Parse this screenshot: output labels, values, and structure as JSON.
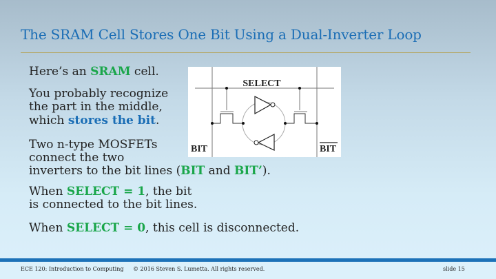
{
  "title": "The SRAM Cell Stores One Bit Using a Dual-Inverter Loop",
  "body": {
    "l1": {
      "a": "Here’s an ",
      "b": "SRAM",
      "c": " cell."
    },
    "l2": "You probably recognize",
    "l3": "the part in the middle,",
    "l4": {
      "a": "which ",
      "b": "stores the bit",
      "c": "."
    },
    "l5": "Two n-type MOSFETs",
    "l6": "connect the two",
    "l7": {
      "a": "inverters to the bit lines (",
      "b": "BIT",
      "c": " and ",
      "d": "BIT’",
      "e": ")."
    },
    "l8": {
      "a": "When ",
      "b": "SELECT = 1",
      "c": ", the bit"
    },
    "l9": "is connected to the bit lines.",
    "l10": {
      "a": "When ",
      "b": "SELECT = 0",
      "c": ", this cell is disconnected."
    }
  },
  "diagram": {
    "select_label": "SELECT",
    "bit_label": "BIT",
    "bit_bar_label": "BIT"
  },
  "footer": {
    "course": "ECE 120: Introduction to Computing",
    "copyright": "© 2016 Steven S. Lumetta.  All rights reserved.",
    "slide": "slide 15"
  },
  "colors": {
    "title": "#1a6db5",
    "highlight_green": "#1aa64a",
    "highlight_blue": "#1a6db5",
    "bar": "#1c72b8"
  }
}
